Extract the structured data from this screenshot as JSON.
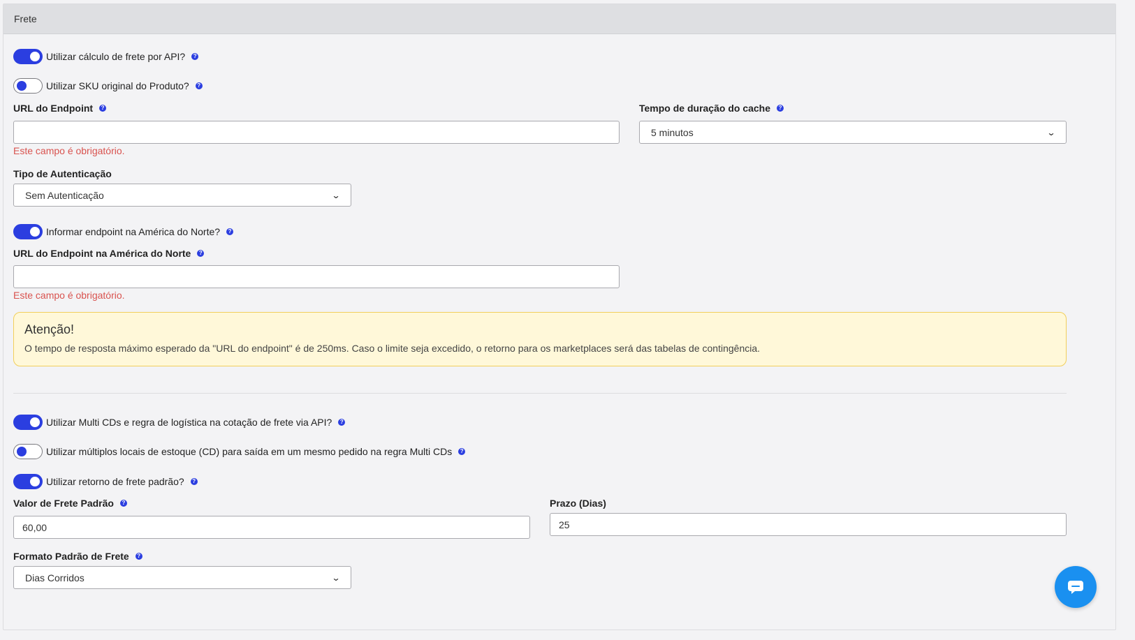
{
  "panel": {
    "title": "Frete"
  },
  "toggles": {
    "api_calc": {
      "label": "Utilizar cálculo de frete por API?",
      "on": true
    },
    "sku_original": {
      "label": "Utilizar SKU original do Produto?",
      "on": false
    },
    "north_america": {
      "label": "Informar endpoint na América do Norte?",
      "on": true
    },
    "multi_cds": {
      "label": "Utilizar Multi CDs e regra de logística na cotação de frete via API?",
      "on": true
    },
    "multi_locations": {
      "label": "Utilizar múltiplos locais de estoque (CD) para saída em um mesmo pedido na regra Multi CDs",
      "on": false
    },
    "default_return": {
      "label": "Utilizar retorno de frete padrão?",
      "on": true
    }
  },
  "fields": {
    "endpoint_url": {
      "label": "URL do Endpoint",
      "value": "",
      "error": "Este campo é obrigatório."
    },
    "cache_duration": {
      "label": "Tempo de duração do cache",
      "selected": "5 minutos"
    },
    "auth_type": {
      "label": "Tipo de Autenticação",
      "selected": "Sem Autenticação"
    },
    "endpoint_na_url": {
      "label": "URL do Endpoint na América do Norte",
      "value": "",
      "error": "Este campo é obrigatório."
    },
    "default_freight_value": {
      "label": "Valor de Frete Padrão",
      "value": "60,00"
    },
    "deadline_days": {
      "label": "Prazo (Dias)",
      "value": "25"
    },
    "default_freight_format": {
      "label": "Formato Padrão de Frete",
      "selected": "Dias Corridos"
    }
  },
  "alert": {
    "title": "Atenção!",
    "text": "O tempo de resposta máximo esperado da \"URL do endpoint\" é de 250ms. Caso o limite seja excedido, o retorno para os marketplaces será das tabelas de contingência."
  },
  "icons": {
    "help": "?",
    "chevron": "⌄"
  },
  "colors": {
    "accent": "#2b3ee0",
    "error": "#d9534f",
    "alert_bg": "#fff8d9",
    "alert_border": "#f2cf5b",
    "chat": "#1a90f0"
  }
}
